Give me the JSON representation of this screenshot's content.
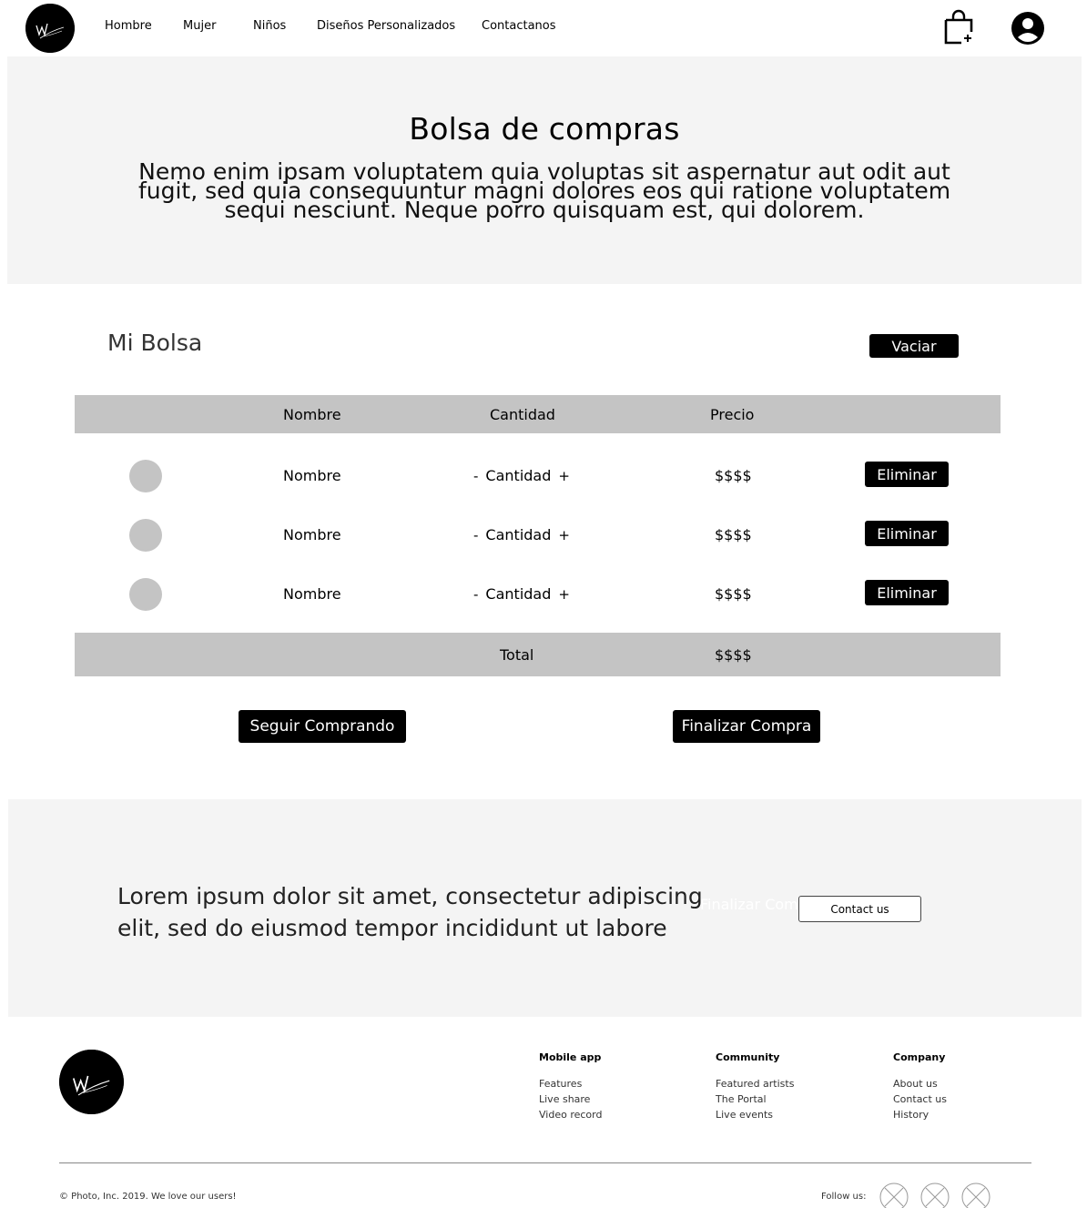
{
  "header": {
    "nav": [
      "Hombre",
      "Mujer",
      "Niños",
      "Diseños Personalizados",
      "Contactanos"
    ]
  },
  "hero": {
    "title": "Bolsa de compras",
    "text": "Nemo enim ipsam voluptatem quia voluptas sit aspernatur aut odit aut fugit, sed quia consequuntur magni dolores eos qui ratione voluptatem sequi nesciunt. Neque porro quisquam est, qui dolorem."
  },
  "bag": {
    "title": "Mi Bolsa",
    "empty_label": "Vaciar",
    "columns": {
      "name": "Nombre",
      "qty": "Cantidad",
      "price": "Precio"
    },
    "items": [
      {
        "name": "Nombre",
        "qty": "Cantidad",
        "price": "$$$$",
        "delete_label": "Eliminar"
      },
      {
        "name": "Nombre",
        "qty": "Cantidad",
        "price": "$$$$",
        "delete_label": "Eliminar"
      },
      {
        "name": "Nombre",
        "qty": "Cantidad",
        "price": "$$$$",
        "delete_label": "Eliminar"
      }
    ],
    "minus": "-",
    "plus": "+",
    "total_label": "Total",
    "total_value": "$$$$",
    "continue_label": "Seguir Comprando",
    "checkout_label": "Finalizar Compra"
  },
  "cta": {
    "text": "Lorem ipsum dolor sit amet, consectetur adipiscing elit, sed do eiusmod tempor incididunt ut labore",
    "ghost_label": "Finalizar Compra",
    "button_label": "Contact us"
  },
  "footer": {
    "columns": [
      {
        "title": "Mobile app",
        "links": [
          "Features",
          "Live share",
          "Video record"
        ]
      },
      {
        "title": "Community",
        "links": [
          "Featured artists",
          "The Portal",
          "Live events"
        ]
      },
      {
        "title": "Company",
        "links": [
          "About us",
          "Contact us",
          "History"
        ]
      }
    ],
    "copyright": "© Photo, Inc. 2019. We love our users!",
    "follow_label": "Follow us:"
  },
  "icons": {
    "logo": "brand-logo-icon",
    "bag": "shopping-bag-add-icon",
    "user": "user-account-icon",
    "social": "placeholder-social-icon"
  }
}
